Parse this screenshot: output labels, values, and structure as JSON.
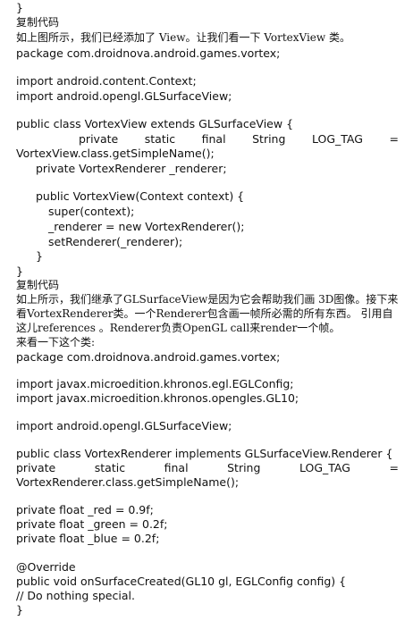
{
  "doc": {
    "l01": "}",
    "l02": "复制代码",
    "l03": "如上图所示，我们已经添加了 View。让我们看一下 VortexView 类。",
    "l04": "package com.droidnova.android.games.vortex;",
    "l05": "import android.content.Context;",
    "l06": "import android.opengl.GLSurfaceView;",
    "l07": "public class VortexView extends GLSurfaceView {",
    "l08_tokens": [
      "private",
      "static",
      "final",
      "String",
      "LOG_TAG",
      "="
    ],
    "l09": "VortexView.class.getSimpleName();",
    "l10": "private VortexRenderer _renderer;",
    "l11": "public VortexView(Context context) {",
    "l12": "super(context);",
    "l13": "_renderer = new VortexRenderer();",
    "l14": "setRenderer(_renderer);",
    "l15": "}",
    "l16": "}",
    "l17": "复制代码",
    "l18": "如上所示，我们继承了GLSurfaceView是因为它会帮助我们画 3D图像。接下来",
    "l19": "看VortexRenderer类。一个Renderer包含画一帧所必需的所有东西。 引用自",
    "l20": "这儿references 。Renderer负责OpenGL call来render一个帧。",
    "l21": "来看一下这个类:",
    "l22": "package com.droidnova.android.games.vortex;",
    "l23": "import javax.microedition.khronos.egl.EGLConfig;",
    "l24": "import javax.microedition.khronos.opengles.GL10;",
    "l25": "import android.opengl.GLSurfaceView;",
    "l26": "public class VortexRenderer implements GLSurfaceView.Renderer {",
    "l27_tokens": [
      "private",
      "static",
      "final",
      "String",
      "LOG_TAG",
      "="
    ],
    "l28": "VortexRenderer.class.getSimpleName();",
    "l29": "private float _red = 0.9f;",
    "l30": "private float _green = 0.2f;",
    "l31": "private float _blue = 0.2f;",
    "l32": "@Override",
    "l33": "public void onSurfaceCreated(GL10 gl, EGLConfig config) {",
    "l34": "// Do nothing special.",
    "l35": "}"
  }
}
